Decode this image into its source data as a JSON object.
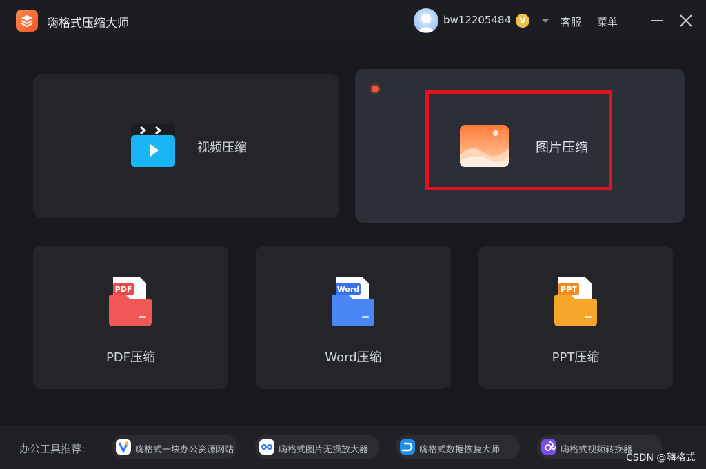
{
  "app": {
    "title": "嗨格式压缩大师",
    "user": "bw12205484",
    "vip_badge": "V",
    "service": "客服",
    "menu": "菜单"
  },
  "tools": {
    "video": "视频压缩",
    "image": "图片压缩",
    "pdf": "PDF压缩",
    "word": "Word压缩",
    "ppt": "PPT压缩"
  },
  "file_tags": {
    "pdf": "PDF",
    "word": "Word",
    "ppt": "PPT"
  },
  "recommend": {
    "label": "办公工具推荐:",
    "items": [
      "嗨格式一块办公资源网站",
      "嗨格式图片无损放大器",
      "嗨格式数据恢复大师",
      "嗨格式视频转换器"
    ]
  },
  "watermark": "CSDN @嗨格式",
  "colors": {
    "accent": "#f0562a",
    "highlight": "#e0141e",
    "background": "#17191c"
  }
}
